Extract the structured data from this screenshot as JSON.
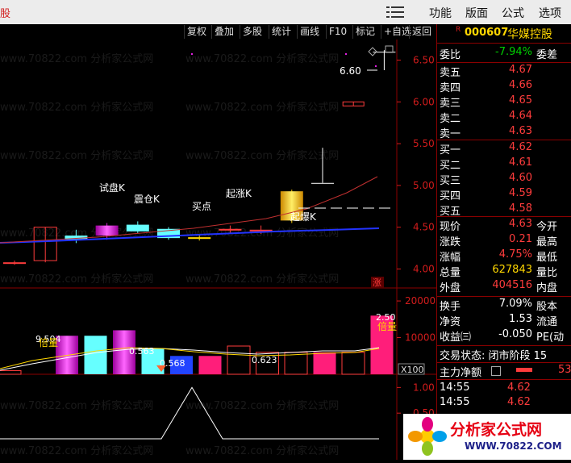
{
  "app": {
    "logo_text": "股",
    "menu": [
      {
        "name": "menu-gongneng",
        "label": "功能"
      },
      {
        "name": "menu-banmian",
        "label": "版面"
      },
      {
        "name": "menu-gongshi",
        "label": "公式"
      },
      {
        "name": "menu-xuanxiang",
        "label": "选项"
      }
    ]
  },
  "toolbar": {
    "buttons": [
      "复权",
      "叠加",
      "多股",
      "统计",
      "画线",
      "F10",
      "标记",
      "+自选",
      "返回"
    ]
  },
  "stock": {
    "code_prefix": "R",
    "code": "000607",
    "name": "华媒控股"
  },
  "quote": {
    "weibi_label": "委比",
    "weibi_value": "-7.94%",
    "weicha_label": "委差",
    "asks": [
      {
        "label": "卖五",
        "price": "4.67"
      },
      {
        "label": "卖四",
        "price": "4.66"
      },
      {
        "label": "卖三",
        "price": "4.65"
      },
      {
        "label": "卖二",
        "price": "4.64"
      },
      {
        "label": "卖一",
        "price": "4.63"
      }
    ],
    "bids": [
      {
        "label": "买一",
        "price": "4.62"
      },
      {
        "label": "买二",
        "price": "4.61"
      },
      {
        "label": "买三",
        "price": "4.60"
      },
      {
        "label": "买四",
        "price": "4.59"
      },
      {
        "label": "买五",
        "price": "4.58"
      }
    ],
    "stats": [
      {
        "label": "现价",
        "value": "4.63",
        "label2": "今开",
        "color": "red"
      },
      {
        "label": "涨跌",
        "value": "0.21",
        "label2": "最高",
        "color": "red"
      },
      {
        "label": "涨幅",
        "value": "4.75%",
        "label2": "最低",
        "color": "red"
      },
      {
        "label": "总量",
        "value": "627843",
        "label2": "量比",
        "color": "yel"
      },
      {
        "label": "外盘",
        "value": "404516",
        "label2": "内盘",
        "color": "red"
      }
    ],
    "stats2": [
      {
        "label": "换手",
        "value": "7.09%",
        "label2": "股本"
      },
      {
        "label": "净资",
        "value": "1.53",
        "label2": "流通"
      },
      {
        "label": "收益㈢",
        "value": "-0.050",
        "label2": "PE(动"
      }
    ],
    "trade_state": "交易状态: 闭市阶段 15",
    "main_net": "主力净额",
    "main_net_val": "53",
    "ticks": [
      {
        "time": "14:55",
        "price": "4.62"
      },
      {
        "time": "14:55",
        "price": "4.62"
      }
    ]
  },
  "chart_data": {
    "type": "candlestick",
    "price_axis": {
      "ticks": [
        "6.50",
        "6.00",
        "5.50",
        "5.00",
        "4.50",
        "4.00"
      ],
      "ylim": [
        3.85,
        6.65
      ]
    },
    "volume_axis": {
      "ticks": [
        "20000",
        "10000"
      ],
      "unit_label": "X100"
    },
    "indicator_axis": {
      "ticks": [
        "1.00",
        "0.50"
      ]
    },
    "candles": [
      {
        "o": 4.08,
        "c": 4.07,
        "h": 4.1,
        "l": 4.05,
        "color": "red"
      },
      {
        "o": 4.1,
        "c": 4.5,
        "h": 4.5,
        "l": 4.08,
        "color": "red"
      },
      {
        "o": 4.4,
        "c": 4.35,
        "h": 4.47,
        "l": 4.31,
        "color": "cyan"
      },
      {
        "o": 4.4,
        "c": 4.52,
        "h": 4.55,
        "l": 4.35,
        "color": "magenta"
      },
      {
        "o": 4.53,
        "c": 4.45,
        "h": 4.57,
        "l": 4.43,
        "color": "cyan"
      },
      {
        "o": 4.48,
        "c": 4.37,
        "h": 4.5,
        "l": 4.35,
        "color": "cyan"
      },
      {
        "o": 4.38,
        "c": 4.36,
        "h": 4.42,
        "l": 4.34,
        "color": "yellow"
      },
      {
        "o": 4.46,
        "c": 4.48,
        "h": 4.52,
        "l": 4.43,
        "color": "red"
      },
      {
        "o": 4.45,
        "c": 4.47,
        "h": 4.52,
        "l": 4.42,
        "color": "red"
      },
      {
        "o": 4.58,
        "c": 4.93,
        "h": 4.95,
        "l": 4.55,
        "color": "gold"
      },
      {
        "o": 5.03,
        "c": 5.03,
        "h": 5.45,
        "l": 5.03,
        "color": "white"
      },
      {
        "o": 5.96,
        "c": 6.0,
        "h": 6.0,
        "l": 5.95,
        "color": "red"
      },
      {
        "o": 6.6,
        "c": 6.6,
        "h": 6.62,
        "l": 6.38,
        "color": "white"
      }
    ],
    "annotations": [
      {
        "label": "试盘K",
        "candle": 3
      },
      {
        "label": "震仓K",
        "candle": 4
      },
      {
        "label": "买点",
        "candle": 6
      },
      {
        "label": "起涨K",
        "candle": 7
      },
      {
        "label": "起爆K",
        "candle": 9
      },
      {
        "label": "6.60",
        "candle": 12
      }
    ],
    "volume": [
      {
        "v": 1000,
        "color": "red"
      },
      {
        "v": 0,
        "color": "red"
      },
      {
        "v": 10500,
        "color": "magenta"
      },
      {
        "v": 10500,
        "color": "cyan"
      },
      {
        "v": 12000,
        "color": "magenta"
      },
      {
        "v": 7000,
        "color": "cyan"
      },
      {
        "v": 5000,
        "color": "blue"
      },
      {
        "v": 5000,
        "color": "hotpink"
      },
      {
        "v": 7700,
        "color": "red"
      },
      {
        "v": 6000,
        "color": "red"
      },
      {
        "v": 6000,
        "color": "red"
      },
      {
        "v": 6000,
        "color": "hotpink"
      },
      {
        "v": 6000,
        "color": "red"
      },
      {
        "v": 16000,
        "color": "hotpink"
      }
    ],
    "volume_labels": [
      {
        "label": "9.504",
        "bar": 2
      },
      {
        "label": "0.563",
        "bar": 5
      },
      {
        "label": "0.568",
        "bar": 6
      },
      {
        "label": "0.623",
        "bar": 9
      },
      {
        "label": "2.50",
        "bar": 13
      }
    ],
    "volume_tags": [
      {
        "label": "倍量",
        "bar": 2
      },
      {
        "label": "倍量",
        "bar": 13
      }
    ],
    "zhang_label": "涨",
    "indicator": {
      "x": [
        0,
        1,
        2,
        3,
        4,
        5,
        6,
        7
      ],
      "values": [
        0,
        0,
        0,
        0,
        1,
        0,
        0,
        0
      ]
    }
  },
  "watermark": {
    "text": "www.70822.com 分析家公式网",
    "logo_main": "分析家公式网",
    "logo_sub": "WWW.70822.COM"
  }
}
